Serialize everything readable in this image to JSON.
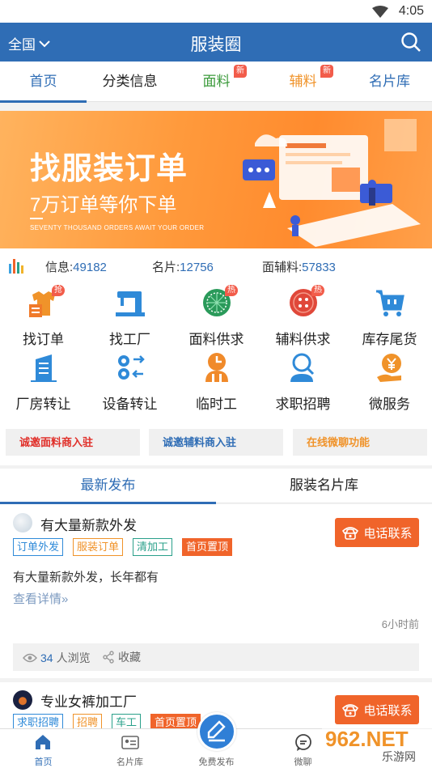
{
  "status": {
    "time": "4:05"
  },
  "appbar": {
    "region": "全国",
    "title": "服装圈"
  },
  "tabs": [
    {
      "label": "首页",
      "color": "#2f6db5"
    },
    {
      "label": "分类信息",
      "color": "#222222"
    },
    {
      "label": "面料",
      "color": "#3a9a3a",
      "badge": "新"
    },
    {
      "label": "辅料",
      "color": "#f0932a",
      "badge": "新"
    },
    {
      "label": "名片库",
      "color": "#2f6db5"
    }
  ],
  "banner": {
    "headline": "找服装订单",
    "subline": "7万订单等你下单",
    "tagline": "SEVENTY THOUSAND ORDERS AWAIT YOUR ORDER"
  },
  "stats": [
    {
      "label": "信息:",
      "value": "49182"
    },
    {
      "label": "名片:",
      "value": "12756"
    },
    {
      "label": "面辅料:",
      "value": "57833"
    }
  ],
  "grid": [
    {
      "label": "找订单",
      "icon": "order-icon",
      "badge": "抢"
    },
    {
      "label": "找工厂",
      "icon": "sewing-machine-icon"
    },
    {
      "label": "面料供求",
      "icon": "fabric-icon",
      "badge": "热"
    },
    {
      "label": "辅料供求",
      "icon": "button-icon",
      "badge": "热"
    },
    {
      "label": "库存尾货",
      "icon": "cart-icon"
    },
    {
      "label": "厂房转让",
      "icon": "building-icon"
    },
    {
      "label": "设备转让",
      "icon": "gears-icon"
    },
    {
      "label": "临时工",
      "icon": "clock-worker-icon"
    },
    {
      "label": "求职招聘",
      "icon": "job-search-icon"
    },
    {
      "label": "微服务",
      "icon": "yuan-hand-icon"
    }
  ],
  "promos": [
    {
      "label": "诚邀面料商入驻",
      "color": "#e0302a"
    },
    {
      "label": "诚邀辅料商入驻",
      "color": "#2f6db5"
    },
    {
      "label": "在线微聊功能",
      "color": "#f0932a"
    }
  ],
  "subtabs": [
    {
      "label": "最新发布"
    },
    {
      "label": "服装名片库"
    }
  ],
  "posts": [
    {
      "title": "有大量新款外发",
      "call": "电话联系",
      "tags": [
        {
          "label": "订单外发",
          "color": "#2f8ad8"
        },
        {
          "label": "服装订单",
          "color": "#f0932a"
        },
        {
          "label": "清加工",
          "color": "#2aa08a"
        },
        {
          "label": "首页置顶",
          "color": "#f0642a",
          "filled": true
        }
      ],
      "desc": "有大量新款外发，长年都有",
      "more": "查看详情»",
      "ago": "6小时前",
      "views": "34",
      "views_label": "人浏览",
      "fav": "收藏"
    },
    {
      "title": "专业女裤加工厂",
      "call": "电话联系",
      "tags": [
        {
          "label": "求职招聘",
          "color": "#2f8ad8"
        },
        {
          "label": "招聘",
          "color": "#f0932a"
        },
        {
          "label": "车工",
          "color": "#2aa08a"
        },
        {
          "label": "首页置顶",
          "color": "#f0642a",
          "filled": true
        }
      ]
    }
  ],
  "bottomnav": [
    {
      "label": "首页",
      "icon": "home-icon"
    },
    {
      "label": "名片库",
      "icon": "card-icon"
    },
    {
      "label": "免费发布",
      "icon": "publish-icon"
    },
    {
      "label": "微聊",
      "icon": "chat-icon"
    }
  ],
  "watermark": {
    "text": "962.NET",
    "sub": "乐游网"
  }
}
